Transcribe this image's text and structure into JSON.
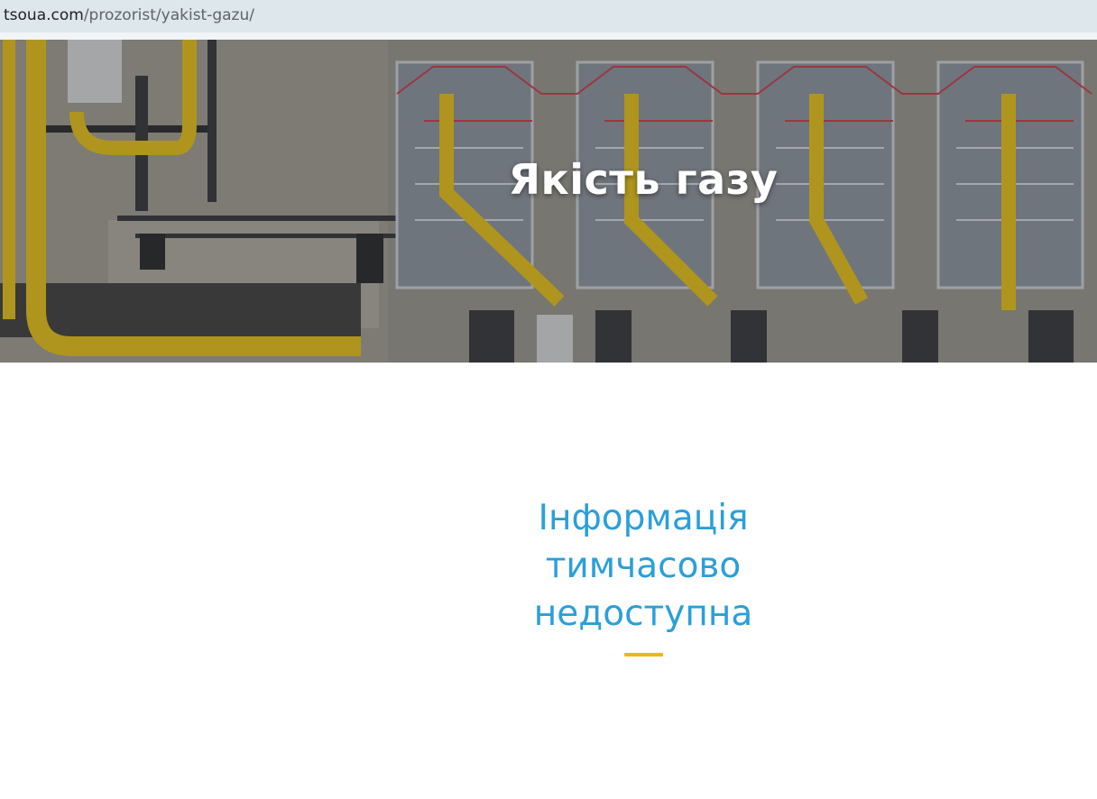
{
  "browser": {
    "url_domain": "tsoua.com",
    "url_path": "/prozorist/yakist-gazu/"
  },
  "hero": {
    "title": "Якість газу"
  },
  "notice": {
    "lines": [
      "Інформація",
      "тимчасово",
      "недоступна"
    ]
  },
  "colors": {
    "notice_text": "#2b9fd9",
    "accent_bar": "#f6b21b",
    "pipe_yellow": "#e8c21c"
  }
}
